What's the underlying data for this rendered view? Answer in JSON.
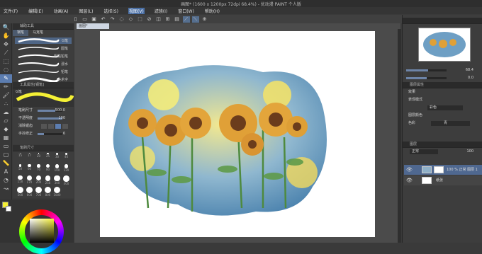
{
  "app": {
    "title": "画图* (1600 x 1200px 72dpi 68.4%) - 优动漫 PAINT 个人版"
  },
  "menu": [
    "文件(F)",
    "编辑(E)",
    "动画(A)",
    "图层(L)",
    "选择(S)",
    "视图(V)",
    "滤镜(I)",
    "窗口(W)",
    "帮助(H)"
  ],
  "menu_active_index": 5,
  "window_controls": [
    "—",
    "□",
    "×"
  ],
  "canvas_tab": "画图*",
  "brush_panel": {
    "header": "辅助工具",
    "tabs": [
      "钢笔",
      "马克笔"
    ],
    "brushes": [
      "G笔",
      "圆笔",
      "粗糙铅笔",
      "浸水",
      "铅笔",
      "美术字"
    ]
  },
  "property_panel": {
    "header": "工具属性[钢笔]",
    "tool_name": "G笔",
    "rows": [
      {
        "label": "笔刷尺寸",
        "value": "500.0"
      },
      {
        "label": "不透明度",
        "value": "100"
      },
      {
        "label": "消除锯齿",
        "value": ""
      },
      {
        "label": "手抖修正",
        "value": "6"
      }
    ]
  },
  "size_panel": {
    "header": "笔刷尺寸",
    "sizes": [
      "15",
      "17",
      "20",
      "25",
      "30",
      "40",
      "50",
      "60",
      "70",
      "80",
      "100",
      "120",
      "150",
      "170",
      "200",
      "250",
      "300",
      "400",
      "500",
      "600",
      "700",
      "800",
      "1000"
    ]
  },
  "right_panel": {
    "navigator_zoom": "68.4",
    "navigator_angle": "0.0",
    "layer_property_header": "图层属性",
    "effect_label": "效果",
    "blend_label": "表现模式",
    "blend_value": "彩色",
    "color_label": "图层颜色",
    "color_sub": "色彩",
    "color_sub_value": "青",
    "layer_header": "图层",
    "blend_mode": "正常",
    "opacity": "100",
    "layers": [
      {
        "name": "100 % 正常\n图层 1",
        "visible": true
      },
      {
        "name": "纸张",
        "visible": true
      }
    ]
  },
  "colors": {
    "accent": "#5c7db0",
    "main_color": "#f5f135",
    "sub_color": "#ffffff"
  }
}
